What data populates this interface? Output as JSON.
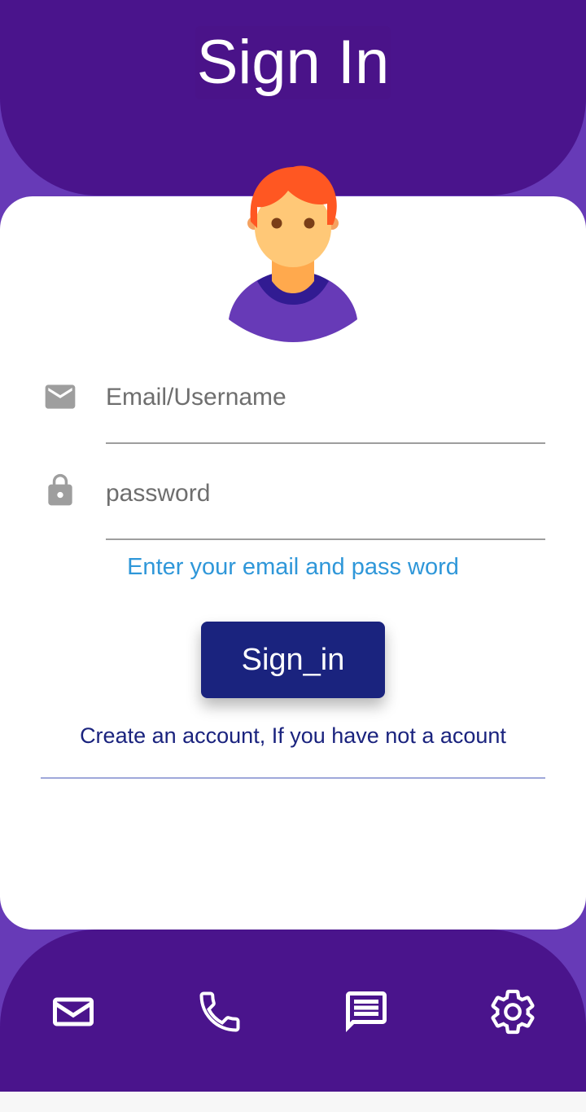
{
  "header": {
    "title": "Sign In"
  },
  "colors": {
    "header_bg": "#4a148c",
    "page_bg": "#673ab7",
    "button_bg": "#1a237e",
    "hint_text": "#2f97d9"
  },
  "form": {
    "email": {
      "icon": "mail-icon",
      "placeholder": "Email/Username",
      "value": ""
    },
    "password": {
      "icon": "lock-icon",
      "placeholder": "password",
      "value": ""
    },
    "hint": "Enter your email and pass word",
    "signin_label": "Sign_in",
    "create_account": "Create an account, If you have not a acount"
  },
  "bottom_nav": [
    {
      "icon": "mail-icon"
    },
    {
      "icon": "phone-icon"
    },
    {
      "icon": "chat-icon"
    },
    {
      "icon": "gear-icon"
    }
  ]
}
